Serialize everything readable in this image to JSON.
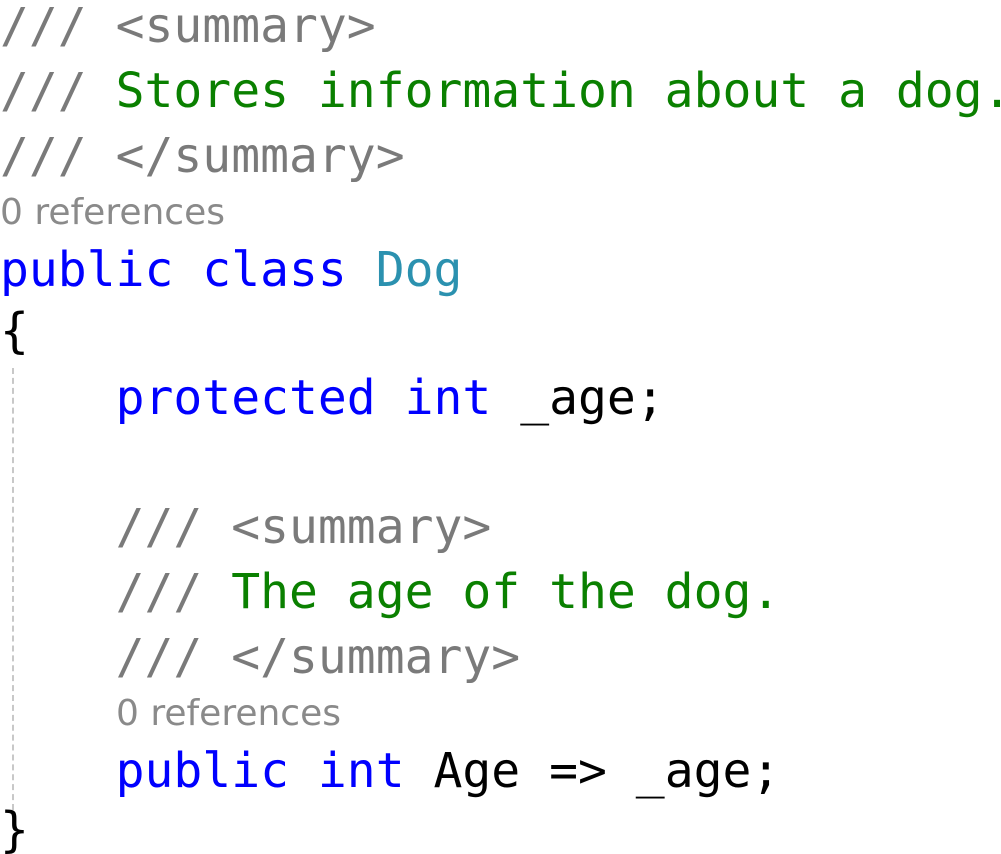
{
  "code": {
    "line1": {
      "delim": "///",
      "tag": "<summary>"
    },
    "line2": {
      "delim": "///",
      "text": "Stores information about a dog."
    },
    "line3": {
      "delim": "///",
      "tag": "</summary>"
    },
    "lens1": "0 references",
    "line4": {
      "kw1": "public",
      "kw2": "class",
      "type": "Dog"
    },
    "line5": {
      "brace": "{"
    },
    "line6": {
      "kw": "protected",
      "kw2": "int",
      "ident": "_age;"
    },
    "line7": {
      "delim": "///",
      "tag": "<summary>"
    },
    "line8": {
      "delim": "///",
      "text": "The age of the dog."
    },
    "line9": {
      "delim": "///",
      "tag": "</summary>"
    },
    "lens2": "0 references",
    "line10": {
      "kw1": "public",
      "kw2": "int",
      "ident": "Age => _age;"
    },
    "line11": {
      "brace": "}"
    }
  },
  "colors": {
    "keyword": "#0000ff",
    "type": "#2b91af",
    "comment": "#0a8000",
    "doc_tag": "#7a7a7a",
    "codelens": "#8a8a8a",
    "text": "#000000",
    "background": "#ffffff"
  }
}
